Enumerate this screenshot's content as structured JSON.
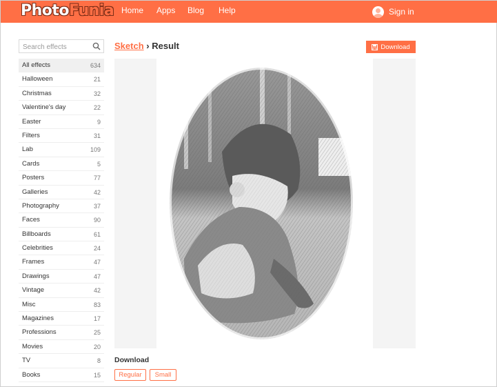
{
  "header": {
    "logo_part1": "Photo",
    "logo_part2": "Funia",
    "nav": [
      "Home",
      "Apps",
      "Blog",
      "Help"
    ],
    "signin_label": "Sign in"
  },
  "search": {
    "placeholder": "Search effects"
  },
  "sidebar": {
    "items": [
      {
        "label": "All effects",
        "count": "634"
      },
      {
        "label": "Halloween",
        "count": "21"
      },
      {
        "label": "Christmas",
        "count": "32"
      },
      {
        "label": "Valentine's day",
        "count": "22"
      },
      {
        "label": "Easter",
        "count": "9"
      },
      {
        "label": "Filters",
        "count": "31"
      },
      {
        "label": "Lab",
        "count": "109"
      },
      {
        "label": "Cards",
        "count": "5"
      },
      {
        "label": "Posters",
        "count": "77"
      },
      {
        "label": "Galleries",
        "count": "42"
      },
      {
        "label": "Photography",
        "count": "37"
      },
      {
        "label": "Faces",
        "count": "90"
      },
      {
        "label": "Billboards",
        "count": "61"
      },
      {
        "label": "Celebrities",
        "count": "24"
      },
      {
        "label": "Frames",
        "count": "47"
      },
      {
        "label": "Drawings",
        "count": "47"
      },
      {
        "label": "Vintage",
        "count": "42"
      },
      {
        "label": "Misc",
        "count": "83"
      },
      {
        "label": "Magazines",
        "count": "17"
      },
      {
        "label": "Professions",
        "count": "25"
      },
      {
        "label": "Movies",
        "count": "20"
      },
      {
        "label": "TV",
        "count": "8"
      },
      {
        "label": "Books",
        "count": "15"
      }
    ]
  },
  "breadcrumb": {
    "link": "Sketch",
    "separator": "›",
    "current": "Result"
  },
  "download_button": "Download",
  "download_section": {
    "title": "Download",
    "sizes": [
      "Regular",
      "Small"
    ]
  },
  "colors": {
    "accent": "#ff6f45"
  }
}
